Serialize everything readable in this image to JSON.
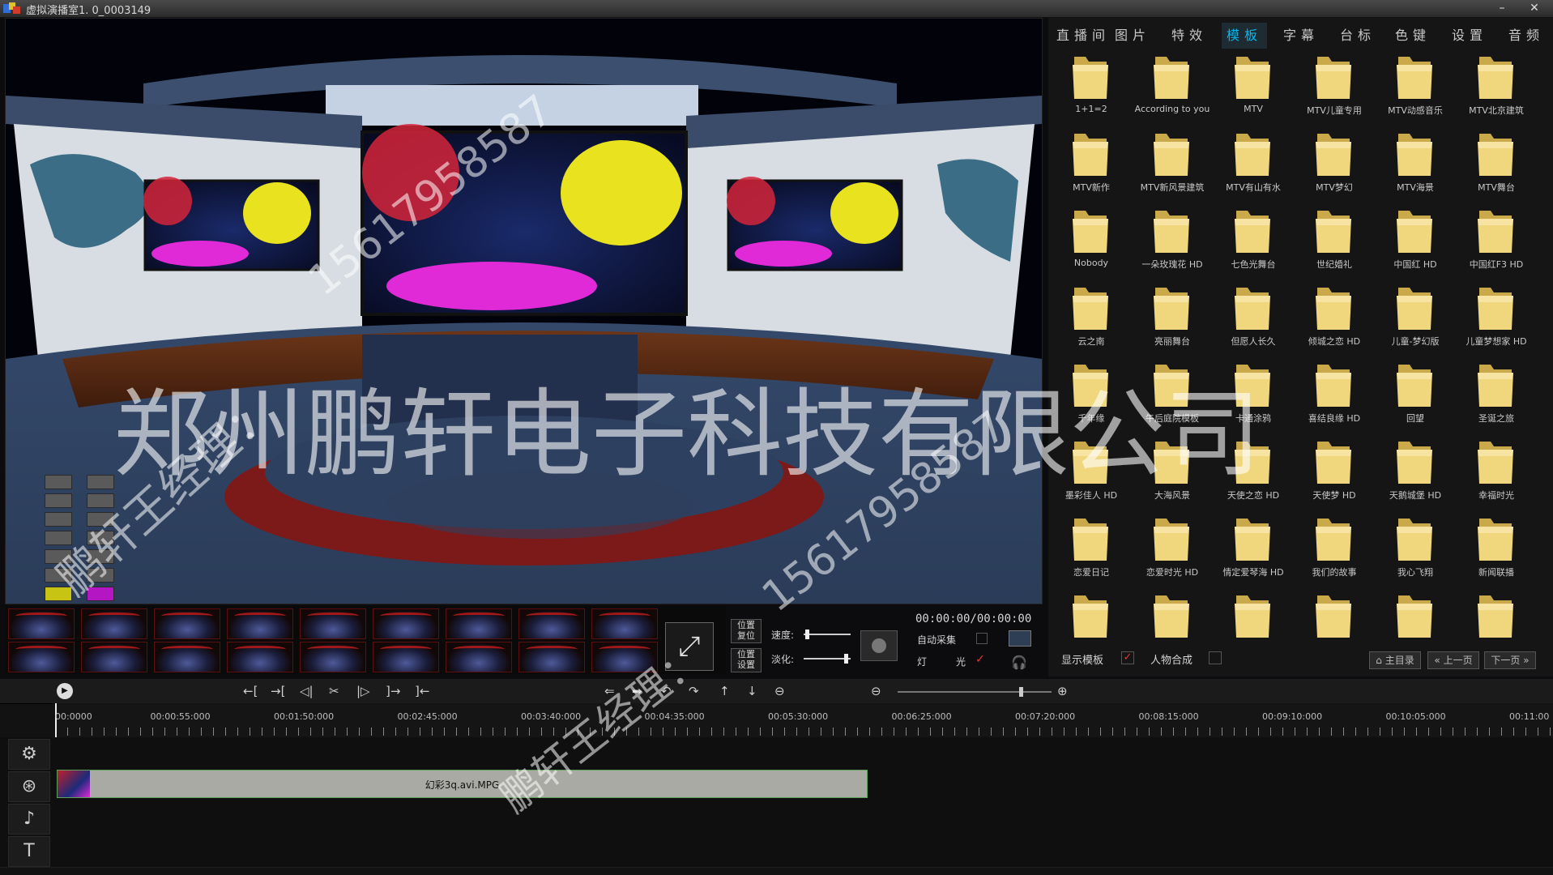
{
  "window": {
    "title": "虚拟演播室1. 0_0003149",
    "minimize": "–",
    "close": "✕"
  },
  "tabs": [
    "直播间",
    "图片",
    "特效",
    "模板",
    "字幕",
    "台标",
    "色键",
    "设置",
    "音频"
  ],
  "active_tab_index": 3,
  "folders": [
    "1+1=2",
    "According to you",
    "MTV",
    "MTV儿童专用",
    "MTV动感音乐",
    "MTV北京建筑",
    "MTV新作",
    "MTV新风景建筑",
    "MTV有山有水",
    "MTV梦幻",
    "MTV海景",
    "MTV舞台",
    "Nobody",
    "一朵玫瑰花 HD",
    "七色光舞台",
    "世纪婚礼",
    "中国红 HD",
    "中国红F3 HD",
    "云之南",
    "亮丽舞台",
    "但愿人长久",
    "倾城之恋 HD",
    "儿童-梦幻版",
    "儿童梦想家 HD",
    "千年缘",
    "午后庭院模板",
    "卡通涂鸦",
    "喜结良缘 HD",
    "回望",
    "圣诞之旅",
    "墨彩佳人 HD",
    "大海风景",
    "天使之恋 HD",
    "天使梦 HD",
    "天鹅城堡 HD",
    "幸福时光",
    "恋爱日记",
    "恋爱时光 HD",
    "情定爱琴海 HD",
    "我们的故事",
    "我心飞翔",
    "新闻联播",
    "",
    "",
    "",
    "",
    "",
    ""
  ],
  "panel_bottom": {
    "show_template": "显示模板",
    "show_template_checked": true,
    "person_compose": "人物合成",
    "person_compose_checked": false,
    "btn_home": "主目录",
    "btn_prev": "上一页",
    "btn_next": "下一页"
  },
  "controls": {
    "reset_position": "位置 复位",
    "set_position": "位置 设置",
    "speed_label": "速度:",
    "fade_label": "淡化:",
    "timecode": "00:00:00/00:00:00",
    "auto_capture": "自动采集",
    "light": "灯",
    "light2": "光"
  },
  "ruler_labels": [
    "00:0000",
    "00:00:55:000",
    "00:01:50:000",
    "00:02:45:000",
    "00:03:40:000",
    "00:04:35:000",
    "00:05:30:000",
    "00:06:25:000",
    "00:07:20:000",
    "00:08:15:000",
    "00:09:10:000",
    "00:10:05:000",
    "00:11:00"
  ],
  "clip": {
    "label": "幻彩3q.avi.MPG"
  },
  "watermarks": {
    "company": "郑州鹏轩电子科技有限公司",
    "phone": "15617958587",
    "manager": "鹏轩王经理："
  },
  "colors": {
    "accent": "#00b9ef",
    "clip_border": "#5da15a",
    "folder": "#f0d77e"
  }
}
